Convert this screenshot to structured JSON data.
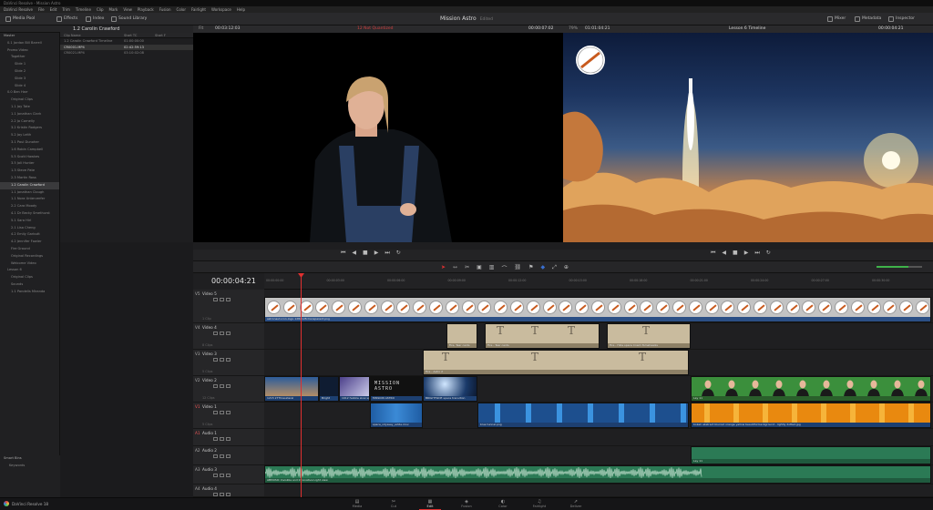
{
  "window": {
    "title": "DaVinci Resolve - Mission Astro"
  },
  "menu": [
    "DaVinci Resolve",
    "File",
    "Edit",
    "Trim",
    "Timeline",
    "Clip",
    "Mark",
    "View",
    "Playback",
    "Fusion",
    "Color",
    "Fairlight",
    "Workspace",
    "Help"
  ],
  "toolbar": {
    "media_pool": "Media Pool",
    "effects": "Effects",
    "index": "Index",
    "sound_library": "Sound Library",
    "project_title": "Mission Astro",
    "project_state": "Edited",
    "mixer": "Mixer",
    "metadata": "Metadata",
    "inspector": "Inspector"
  },
  "bins": {
    "header": "Master",
    "items": [
      "0.1 Jordan Bill Barrell",
      "Promo Video",
      "Together",
      "Slide 1",
      "Slide 2",
      "Slide 3",
      "Slide 4",
      "0.0 Ben Harr",
      "Original Clips",
      "1.1 Jay Tate",
      "1.1 Jonathan Clark",
      "2.2 Jo Cornelly",
      "3.2 Kristin Rodgers",
      "5.2 Jay Leith",
      "3.1 Paul Dunoher",
      "1.6 Robin Campbell",
      "5.5 Scott Hawkes",
      "3.5 Joli Hunter",
      "1.3 Steve Pate",
      "2.3 Martin Ross",
      "1.2 Carolin Crawford",
      "1.1 Jonathan Clough",
      "1.1 Nora Unterverfer",
      "2.2 Cara Moody",
      "4.1 Dr Becky Smethurst",
      "5.1 Sara Hirl",
      "2.1 Lisa Cheng",
      "4.2 Emily Garbutt",
      "4.2 Jennifer Fowler",
      "Fire Ground",
      "Original Recordings",
      "Welcome Video",
      "Lesson 6",
      "Original Clips",
      "Sounds",
      "1.1 Pandelis Miranda"
    ],
    "selected_index": 20,
    "smart_bins_label": "Smart Bins",
    "keywords": "Keywords"
  },
  "clip_panel": {
    "bin_title": "1.2 Carolin Crawford",
    "columns": [
      "Clip Name",
      "Start TC",
      "Start F"
    ],
    "rows": [
      {
        "name": "1.2 Carolin Crawford Timeline",
        "tc": "01:00:00:00",
        "f": "",
        "sel": false
      },
      {
        "name": "CR0001.MP4",
        "tc": "02:42:59:13",
        "f": "",
        "sel": true
      },
      {
        "name": "CR0021.MP4",
        "tc": "03:10:02:08",
        "f": "",
        "sel": false
      }
    ]
  },
  "source_viewer": {
    "zoom": "Fit",
    "duration": "00:03:12:03",
    "warning": "12 Not Quantized",
    "timecode": "00:00:07:02"
  },
  "program_viewer": {
    "zoom": "79%",
    "duration": "01:01:04:21",
    "timeline_name": "Lesson 6 Timeline",
    "timecode": "00:00:04:21"
  },
  "timeline": {
    "timecode": "00:00:04:21",
    "ruler_ticks": [
      "00:00:00:00",
      "00:00:03:00",
      "00:00:06:00",
      "00:00:09:00",
      "00:00:12:00",
      "00:00:15:00",
      "00:00:18:00",
      "00:00:21:00",
      "00:00:24:00",
      "00:00:27:00",
      "00:00:30:00"
    ],
    "tracks": [
      {
        "id": "V5",
        "name": "Video 5",
        "sub": "1 Clip"
      },
      {
        "id": "V4",
        "name": "Video 4",
        "sub": "8 Clips"
      },
      {
        "id": "V3",
        "name": "Video 3",
        "sub": "5 Clips"
      },
      {
        "id": "V2",
        "name": "Video 2",
        "sub": "12 Clips"
      },
      {
        "id": "V1",
        "name": "Video 1",
        "sub": "5 Clips"
      },
      {
        "id": "A1",
        "name": "Audio 1",
        "sub": ""
      },
      {
        "id": "A2",
        "name": "Audio 2",
        "sub": ""
      },
      {
        "id": "A3",
        "name": "Audio 3",
        "sub": ""
      },
      {
        "id": "A4",
        "name": "Audio 4",
        "sub": ""
      }
    ],
    "clip_labels": {
      "v5": "astronaut-icon-logo-128x128-transparent.png",
      "v4a": "Fire, Tear cards",
      "v4b": "Fire - Tear cards",
      "v4c": "Fire - Hide space Crash Tomahawks",
      "v3a": "Fire - Astro 2",
      "v2a": "1215 27Thresideral",
      "v2b": "Bright",
      "v2c": "1912 hubble slow space earth",
      "v2d": "MISSION ASTRO",
      "v2e": "BRIGHTSIDE space transition",
      "v2f": "Lay 11",
      "v1a": "space_odyssey_sidde.mov",
      "v1b": "blue tunnel.png",
      "v1c": "bokeh abstract blurred orange yellow beautiful background - lightly dotted.jpg",
      "a2": "Lay 11",
      "a3": "ABMUSIC Invisible and Innovative Light view"
    }
  },
  "pages": [
    {
      "name": "Media",
      "glyph": "▤"
    },
    {
      "name": "Cut",
      "glyph": "✂"
    },
    {
      "name": "Edit",
      "glyph": "▦"
    },
    {
      "name": "Fusion",
      "glyph": "◈"
    },
    {
      "name": "Color",
      "glyph": "◐"
    },
    {
      "name": "Fairlight",
      "glyph": "♫"
    },
    {
      "name": "Deliver",
      "glyph": "➚"
    }
  ],
  "active_page": "Edit",
  "app_name": "DaVinci Resolve 18"
}
